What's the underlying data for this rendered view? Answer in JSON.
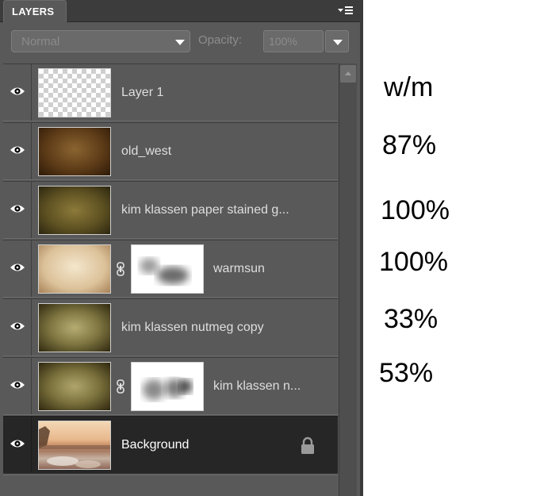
{
  "panel": {
    "tab_title": "LAYERS",
    "menu_icon": "panel-menu-icon",
    "blend_mode": {
      "value": "Normal"
    },
    "opacity": {
      "label": "Opacity:",
      "value": "100%"
    }
  },
  "layers": [
    {
      "name": "Layer 1",
      "visible": true,
      "thumbnail": "transparent",
      "smart_object": false,
      "has_mask": false
    },
    {
      "name": "old_west",
      "visible": true,
      "thumbnail": "texture-brown",
      "smart_object": true,
      "has_mask": false
    },
    {
      "name": "kim klassen paper stained g...",
      "visible": true,
      "thumbnail": "texture-olive",
      "smart_object": true,
      "has_mask": false
    },
    {
      "name": "warmsun",
      "visible": true,
      "thumbnail": "texture-cream",
      "smart_object": true,
      "has_mask": true
    },
    {
      "name": "kim klassen nutmeg copy",
      "visible": true,
      "thumbnail": "texture-olive",
      "smart_object": true,
      "has_mask": false
    },
    {
      "name": "kim klassen n...",
      "visible": true,
      "thumbnail": "texture-olive",
      "smart_object": true,
      "has_mask": true
    },
    {
      "name": "Background",
      "visible": true,
      "thumbnail": "photo",
      "locked": true,
      "selected": true
    }
  ],
  "annotations": [
    "w/m",
    "87%",
    "100%",
    "100%",
    "33%",
    "53%"
  ],
  "colors": {
    "panel_bg": "#595959",
    "selected_row": "#262626",
    "tab_bar": "#3c3c3c"
  }
}
